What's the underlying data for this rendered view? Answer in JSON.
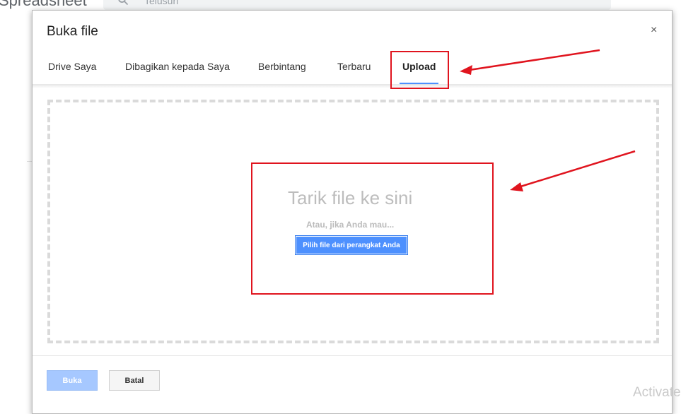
{
  "background": {
    "app_name": "Spreadsheet",
    "search_placeholder": "Telusuri",
    "watermark": "Activate"
  },
  "dialog": {
    "title": "Buka file",
    "close_glyph": "×",
    "tabs": [
      {
        "label": "Drive Saya",
        "active": false
      },
      {
        "label": "Dibagikan kepada Saya",
        "active": false
      },
      {
        "label": "Berbintang",
        "active": false
      },
      {
        "label": "Terbaru",
        "active": false
      },
      {
        "label": "Upload",
        "active": true
      }
    ],
    "drop_zone": {
      "title": "Tarik file ke sini",
      "or_text": "Atau, jika Anda mau...",
      "pick_button": "Pilih file dari perangkat Anda"
    },
    "footer": {
      "open_label": "Buka",
      "open_enabled": false,
      "cancel_label": "Batal"
    }
  },
  "colors": {
    "accent": "#4d90fe",
    "annotation": "#e0141e",
    "disabled_button": "#a6c8ff"
  },
  "icons": {
    "search": "search-icon",
    "close": "close-icon"
  }
}
